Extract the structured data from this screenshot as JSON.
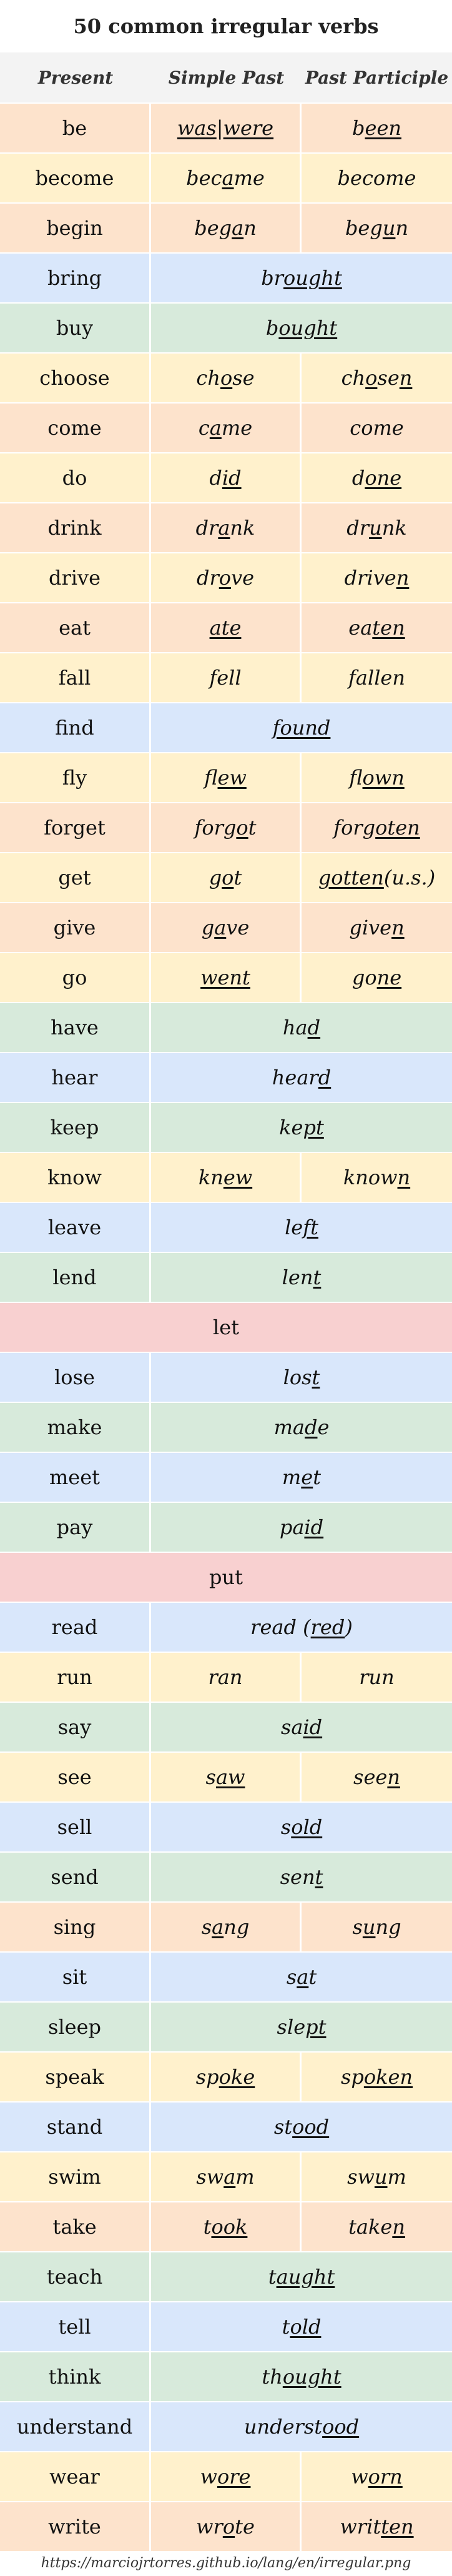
{
  "title": "50 common irregular verbs",
  "headers": [
    "Present",
    "Simple Past",
    "Past Participle"
  ],
  "colors": {
    "orange": "#fde3cc",
    "yellow": "#fff1cc",
    "blue": "#d9e7fb",
    "green": "#d7eadb",
    "red": "#f8d0d0"
  },
  "rows": [
    {
      "present": "be",
      "past": [
        {
          "t": "was",
          "u": true
        },
        {
          "t": " | "
        },
        {
          "t": "were",
          "u": true
        }
      ],
      "participle": [
        {
          "t": "b"
        },
        {
          "t": "een",
          "u": true
        }
      ],
      "color": "orange",
      "span": 1
    },
    {
      "present": "become",
      "past": [
        {
          "t": "bec"
        },
        {
          "t": "a",
          "u": true
        },
        {
          "t": "me"
        }
      ],
      "participle": [
        {
          "t": "become"
        }
      ],
      "color": "yellow",
      "span": 1
    },
    {
      "present": "begin",
      "past": [
        {
          "t": "beg"
        },
        {
          "t": "a",
          "u": true
        },
        {
          "t": "n"
        }
      ],
      "participle": [
        {
          "t": "beg"
        },
        {
          "t": "u",
          "u": true
        },
        {
          "t": "n"
        }
      ],
      "color": "orange",
      "span": 1
    },
    {
      "present": "bring",
      "past": [
        {
          "t": "br"
        },
        {
          "t": "ought",
          "u": true
        }
      ],
      "color": "blue",
      "span": 2
    },
    {
      "present": "buy",
      "past": [
        {
          "t": "b"
        },
        {
          "t": "ought",
          "u": true
        }
      ],
      "color": "green",
      "span": 2
    },
    {
      "present": "choose",
      "past": [
        {
          "t": "ch"
        },
        {
          "t": "o",
          "u": true
        },
        {
          "t": "se"
        }
      ],
      "participle": [
        {
          "t": "ch"
        },
        {
          "t": "o",
          "u": true
        },
        {
          "t": "se"
        },
        {
          "t": "n",
          "u": true
        }
      ],
      "color": "yellow",
      "span": 1
    },
    {
      "present": "come",
      "past": [
        {
          "t": "c"
        },
        {
          "t": "a",
          "u": true
        },
        {
          "t": "me"
        }
      ],
      "participle": [
        {
          "t": "come"
        }
      ],
      "color": "orange",
      "span": 1
    },
    {
      "present": "do",
      "past": [
        {
          "t": "d"
        },
        {
          "t": "id",
          "u": true
        }
      ],
      "participle": [
        {
          "t": "d"
        },
        {
          "t": "one",
          "u": true
        }
      ],
      "color": "yellow",
      "span": 1
    },
    {
      "present": "drink",
      "past": [
        {
          "t": "dr"
        },
        {
          "t": "a",
          "u": true
        },
        {
          "t": "nk"
        }
      ],
      "participle": [
        {
          "t": "dr"
        },
        {
          "t": "u",
          "u": true
        },
        {
          "t": "nk"
        }
      ],
      "color": "orange",
      "span": 1
    },
    {
      "present": "drive",
      "past": [
        {
          "t": "dr"
        },
        {
          "t": "o",
          "u": true
        },
        {
          "t": "ve"
        }
      ],
      "participle": [
        {
          "t": "drive"
        },
        {
          "t": "n",
          "u": true
        }
      ],
      "color": "yellow",
      "span": 1
    },
    {
      "present": "eat",
      "past": [
        {
          "t": "ate",
          "u": true
        }
      ],
      "participle": [
        {
          "t": "ea"
        },
        {
          "t": "ten",
          "u": true
        }
      ],
      "color": "orange",
      "span": 1
    },
    {
      "present": "fall",
      "past": [
        {
          "t": "fell"
        }
      ],
      "participle": [
        {
          "t": "fallen"
        }
      ],
      "color": "yellow",
      "span": 1
    },
    {
      "present": "find",
      "past": [
        {
          "t": "found",
          "u": true
        }
      ],
      "color": "blue",
      "span": 2
    },
    {
      "present": "fly",
      "past": [
        {
          "t": "fl"
        },
        {
          "t": "ew",
          "u": true
        }
      ],
      "participle": [
        {
          "t": "fl"
        },
        {
          "t": "own",
          "u": true
        }
      ],
      "color": "yellow",
      "span": 1
    },
    {
      "present": "forget",
      "past": [
        {
          "t": "forg"
        },
        {
          "t": "o",
          "u": true
        },
        {
          "t": "t"
        }
      ],
      "participle": [
        {
          "t": "forg"
        },
        {
          "t": "oten",
          "u": true
        }
      ],
      "color": "orange",
      "span": 1
    },
    {
      "present": "get",
      "past": [
        {
          "t": "g"
        },
        {
          "t": "o",
          "u": true
        },
        {
          "t": "t"
        }
      ],
      "participle": [
        {
          "t": "gotten",
          "u": true
        },
        {
          "t": " (u.s.)"
        }
      ],
      "color": "yellow",
      "span": 1
    },
    {
      "present": "give",
      "past": [
        {
          "t": "g"
        },
        {
          "t": "a",
          "u": true
        },
        {
          "t": "ve"
        }
      ],
      "participle": [
        {
          "t": "give"
        },
        {
          "t": "n",
          "u": true
        }
      ],
      "color": "orange",
      "span": 1
    },
    {
      "present": "go",
      "past": [
        {
          "t": "went",
          "u": true
        }
      ],
      "participle": [
        {
          "t": "go"
        },
        {
          "t": "ne",
          "u": true
        }
      ],
      "color": "yellow",
      "span": 1
    },
    {
      "present": "have",
      "past": [
        {
          "t": "ha"
        },
        {
          "t": "d",
          "u": true
        }
      ],
      "color": "green",
      "span": 2
    },
    {
      "present": "hear",
      "past": [
        {
          "t": "hear"
        },
        {
          "t": "d",
          "u": true
        }
      ],
      "color": "blue",
      "span": 2
    },
    {
      "present": "keep",
      "past": [
        {
          "t": "ke"
        },
        {
          "t": "pt",
          "u": true
        }
      ],
      "color": "green",
      "span": 2
    },
    {
      "present": "know",
      "past": [
        {
          "t": "kn"
        },
        {
          "t": "ew",
          "u": true
        }
      ],
      "participle": [
        {
          "t": "know"
        },
        {
          "t": "n",
          "u": true
        }
      ],
      "color": "yellow",
      "span": 1
    },
    {
      "present": "leave",
      "past": [
        {
          "t": "le"
        },
        {
          "t": "ft",
          "u": true
        }
      ],
      "color": "blue",
      "span": 2
    },
    {
      "present": "lend",
      "past": [
        {
          "t": "len"
        },
        {
          "t": "t",
          "u": true
        }
      ],
      "color": "green",
      "span": 2
    },
    {
      "present": "let",
      "color": "red",
      "span": 3
    },
    {
      "present": "lose",
      "past": [
        {
          "t": "los"
        },
        {
          "t": "t",
          "u": true
        }
      ],
      "color": "blue",
      "span": 2
    },
    {
      "present": "make",
      "past": [
        {
          "t": "ma"
        },
        {
          "t": "d",
          "u": true
        },
        {
          "t": "e"
        }
      ],
      "color": "green",
      "span": 2
    },
    {
      "present": "meet",
      "past": [
        {
          "t": "m"
        },
        {
          "t": "e",
          "u": true
        },
        {
          "t": "t"
        }
      ],
      "color": "blue",
      "span": 2
    },
    {
      "present": "pay",
      "past": [
        {
          "t": "pa"
        },
        {
          "t": "id",
          "u": true
        }
      ],
      "color": "green",
      "span": 2
    },
    {
      "present": "put",
      "color": "red",
      "span": 3
    },
    {
      "present": "read",
      "past": [
        {
          "t": "read ("
        },
        {
          "t": "red",
          "u": true
        },
        {
          "t": ")"
        }
      ],
      "color": "blue",
      "span": 2
    },
    {
      "present": "run",
      "past": [
        {
          "t": "ran"
        }
      ],
      "participle": [
        {
          "t": "run"
        }
      ],
      "color": "yellow",
      "span": 1
    },
    {
      "present": "say",
      "past": [
        {
          "t": "sa"
        },
        {
          "t": "id",
          "u": true
        }
      ],
      "color": "green",
      "span": 2
    },
    {
      "present": "see",
      "past": [
        {
          "t": "s"
        },
        {
          "t": "aw",
          "u": true
        }
      ],
      "participle": [
        {
          "t": "see"
        },
        {
          "t": "n",
          "u": true
        }
      ],
      "color": "yellow",
      "span": 1
    },
    {
      "present": "sell",
      "past": [
        {
          "t": "s"
        },
        {
          "t": "old",
          "u": true
        }
      ],
      "color": "blue",
      "span": 2
    },
    {
      "present": "send",
      "past": [
        {
          "t": "sen"
        },
        {
          "t": "t",
          "u": true
        }
      ],
      "color": "green",
      "span": 2
    },
    {
      "present": "sing",
      "past": [
        {
          "t": "s"
        },
        {
          "t": "a",
          "u": true
        },
        {
          "t": "ng"
        }
      ],
      "participle": [
        {
          "t": "s"
        },
        {
          "t": "u",
          "u": true
        },
        {
          "t": "ng"
        }
      ],
      "color": "orange",
      "span": 1
    },
    {
      "present": "sit",
      "past": [
        {
          "t": "s"
        },
        {
          "t": "a",
          "u": true
        },
        {
          "t": "t"
        }
      ],
      "color": "blue",
      "span": 2
    },
    {
      "present": "sleep",
      "past": [
        {
          "t": "sle"
        },
        {
          "t": "pt",
          "u": true
        }
      ],
      "color": "green",
      "span": 2
    },
    {
      "present": "speak",
      "past": [
        {
          "t": "sp"
        },
        {
          "t": "oke",
          "u": true
        }
      ],
      "participle": [
        {
          "t": "sp"
        },
        {
          "t": "oken",
          "u": true
        }
      ],
      "color": "yellow",
      "span": 1
    },
    {
      "present": "stand",
      "past": [
        {
          "t": "st"
        },
        {
          "t": "ood",
          "u": true
        }
      ],
      "color": "blue",
      "span": 2
    },
    {
      "present": "swim",
      "past": [
        {
          "t": "sw"
        },
        {
          "t": "a",
          "u": true
        },
        {
          "t": "m"
        }
      ],
      "participle": [
        {
          "t": "sw"
        },
        {
          "t": "u",
          "u": true
        },
        {
          "t": "m"
        }
      ],
      "color": "yellow",
      "span": 1
    },
    {
      "present": "take",
      "past": [
        {
          "t": "t"
        },
        {
          "t": "ook",
          "u": true
        }
      ],
      "participle": [
        {
          "t": "take"
        },
        {
          "t": "n",
          "u": true
        }
      ],
      "color": "orange",
      "span": 1
    },
    {
      "present": "teach",
      "past": [
        {
          "t": "t"
        },
        {
          "t": "aught",
          "u": true
        }
      ],
      "color": "green",
      "span": 2
    },
    {
      "present": "tell",
      "past": [
        {
          "t": "t"
        },
        {
          "t": "old",
          "u": true
        }
      ],
      "color": "blue",
      "span": 2
    },
    {
      "present": "think",
      "past": [
        {
          "t": "th"
        },
        {
          "t": "ought",
          "u": true
        }
      ],
      "color": "green",
      "span": 2
    },
    {
      "present": "understand",
      "past": [
        {
          "t": "underst"
        },
        {
          "t": "ood",
          "u": true
        }
      ],
      "color": "blue",
      "span": 2
    },
    {
      "present": "wear",
      "past": [
        {
          "t": "w"
        },
        {
          "t": "ore",
          "u": true
        }
      ],
      "participle": [
        {
          "t": "w"
        },
        {
          "t": "orn",
          "u": true
        }
      ],
      "color": "yellow",
      "span": 1
    },
    {
      "present": "write",
      "past": [
        {
          "t": "wr"
        },
        {
          "t": "o",
          "u": true
        },
        {
          "t": "te"
        }
      ],
      "participle": [
        {
          "t": "writ"
        },
        {
          "t": "ten",
          "u": true
        }
      ],
      "color": "orange",
      "span": 1
    }
  ],
  "footer": "https://marciojrtorres.github.io/lang/en/irregular.png"
}
